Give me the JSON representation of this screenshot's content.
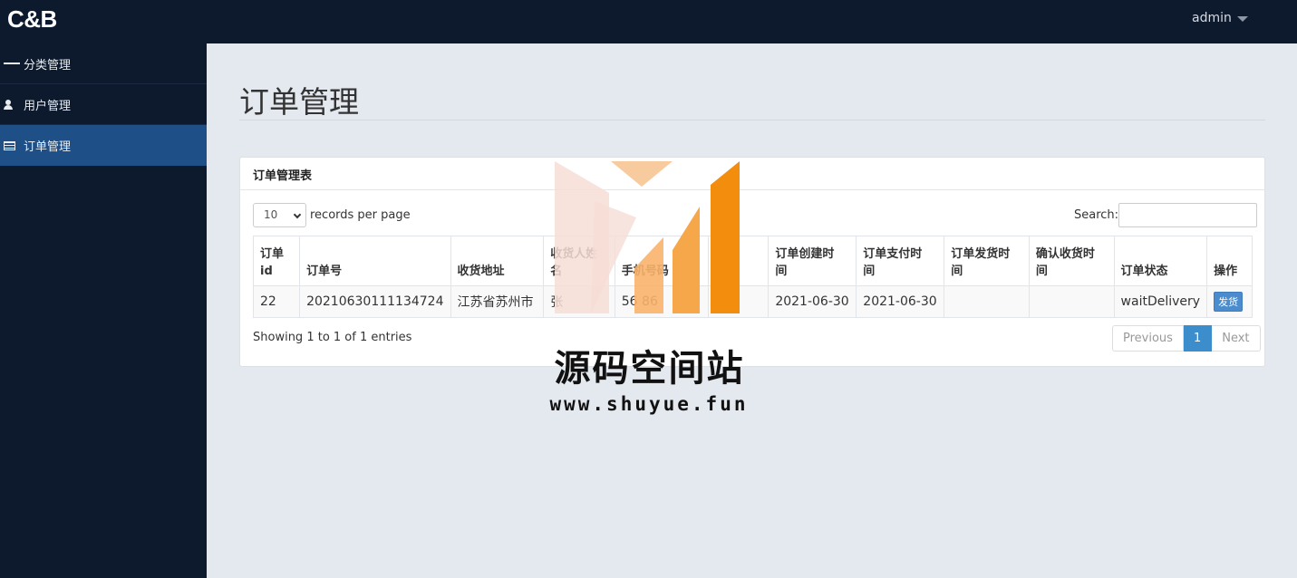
{
  "app": {
    "brand": "C&B"
  },
  "header": {
    "user": "admin"
  },
  "sidebar": {
    "items": [
      {
        "label": "分类管理",
        "icon": "bars-icon",
        "active": false
      },
      {
        "label": "用户管理",
        "icon": "user-icon",
        "active": false
      },
      {
        "label": "订单管理",
        "icon": "table-icon",
        "active": true
      }
    ]
  },
  "page": {
    "title": "订单管理"
  },
  "panel": {
    "title": "订单管理表",
    "length": {
      "value": "10",
      "suffix": "records per page"
    },
    "search": {
      "label": "Search:",
      "value": ""
    },
    "columns": [
      "订单\nid",
      "订单号",
      "收货地址",
      "收货人姓\n名",
      "手机号码",
      "备注",
      "订单创建时\n间",
      "订单支付时\n间",
      "订单发货时\n间",
      "确认收货时\n间",
      "订单状态",
      "操作"
    ],
    "rows": [
      {
        "id": "22",
        "order_no": "20210630111134724",
        "address": "江苏省苏州市",
        "receiver": "张",
        "phone": "56 86",
        "remark": "",
        "created": "2021-06-30",
        "paid": "2021-06-30",
        "shipped": "",
        "confirmed": "",
        "status": "waitDelivery",
        "action": "发货"
      }
    ],
    "info": "Showing 1 to 1 of 1 entries",
    "pager": {
      "prev": "Previous",
      "page": "1",
      "next": "Next"
    }
  },
  "watermark": {
    "title": "源码空间站",
    "url": "www.shuyue.fun"
  },
  "colors": {
    "nav_bg": "#0d1a2e",
    "nav_active": "#1f4f87",
    "page_bg": "#e4e8ef",
    "accent": "#3c8dcb"
  }
}
